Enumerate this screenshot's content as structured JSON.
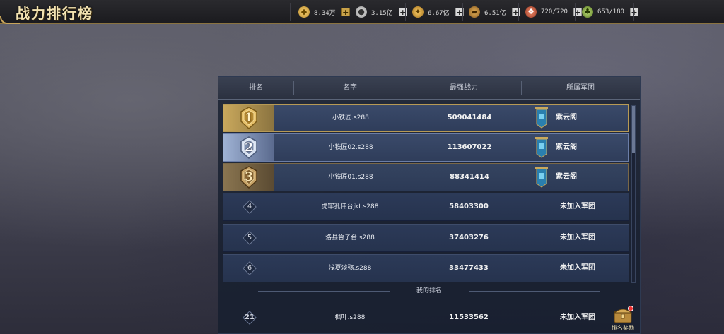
{
  "header": {
    "title": "战力排行榜"
  },
  "resources": [
    {
      "icon": "gold-ingot-icon",
      "value": "8.34万",
      "plus_style": "gold"
    },
    {
      "icon": "silver-coin-icon",
      "value": "3.15亿",
      "plus_style": "plain"
    },
    {
      "icon": "wheat-icon",
      "value": "6.67亿",
      "plus_style": "plain"
    },
    {
      "icon": "lumber-icon",
      "value": "6.51亿",
      "plus_style": "plain"
    },
    {
      "icon": "meat-icon",
      "value": "720/720",
      "plus_style": "plain"
    },
    {
      "icon": "herb-icon",
      "value": "653/180",
      "plus_style": "plain"
    }
  ],
  "table": {
    "columns": [
      "排名",
      "名字",
      "最强战力",
      "所属军团"
    ],
    "rows": [
      {
        "rank": "1",
        "name": "小铁匠.s288",
        "power": "509041484",
        "legion": "紫云阁"
      },
      {
        "rank": "2",
        "name": "小铁匠02.s288",
        "power": "113607022",
        "legion": "紫云阁"
      },
      {
        "rank": "3",
        "name": "小铁匠01.s288",
        "power": "88341414",
        "legion": "紫云阁"
      },
      {
        "rank": "4",
        "name": "虎牢孔伟台jkt.s288",
        "power": "58403300",
        "legion": "未加入军团"
      },
      {
        "rank": "5",
        "name": "洛县鲁子台.s288",
        "power": "37403276",
        "legion": "未加入军团"
      },
      {
        "rank": "6",
        "name": "浅夏淡殇.s288",
        "power": "33477433",
        "legion": "未加入军团"
      }
    ]
  },
  "my_rank": {
    "label": "我的排名",
    "rank": "21",
    "name": "枫叶.s288",
    "power": "11533562",
    "legion": "未加入军团"
  },
  "reward_button": {
    "label": "排名奖励"
  },
  "colors": {
    "gold": "#c9a85c",
    "silver": "#9fb2d4",
    "bronze": "#8a7550",
    "row_bg": "#2c3a58"
  }
}
